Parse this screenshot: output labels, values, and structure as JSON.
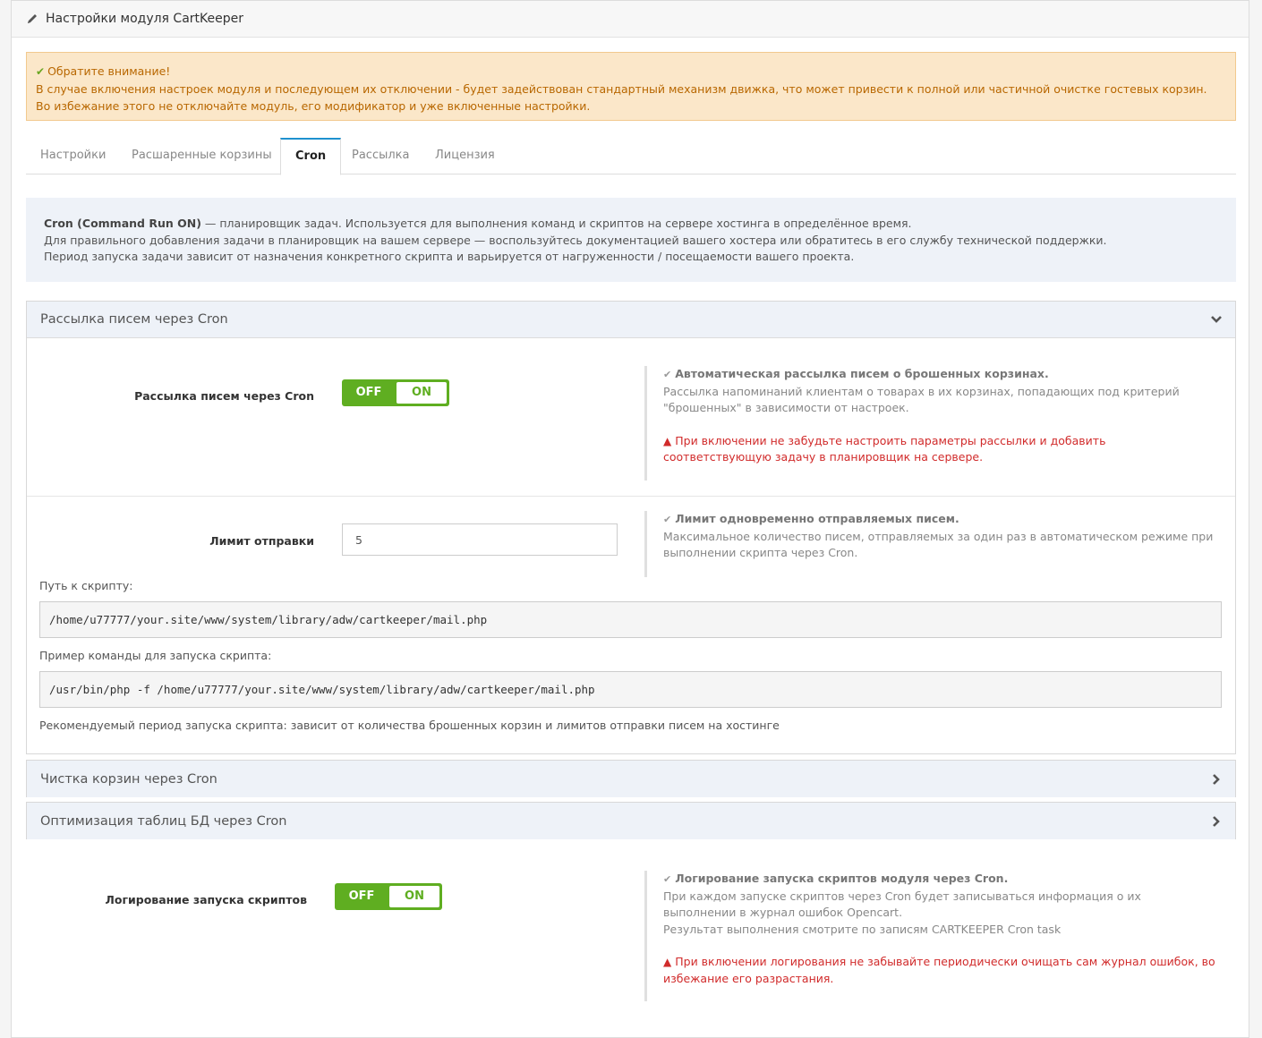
{
  "header": {
    "title": "Настройки модуля CartKeeper"
  },
  "alert": {
    "title": "Обратите внимание!",
    "line1": "В случае включения настроек модуля и последующем их отключении - будет задействован стандартный механизм движка, что может привести к полной или частичной очистке гостевых корзин.",
    "line2": "Во избежание этого не отключайте модуль, его модификатор и уже включенные настройки."
  },
  "tabs": [
    {
      "label": "Настройки"
    },
    {
      "label": "Расшаренные корзины"
    },
    {
      "label": "Cron"
    },
    {
      "label": "Рассылка"
    },
    {
      "label": "Лицензия"
    }
  ],
  "info": {
    "bold": "Cron (Command Run ON)",
    "line1_rest": " — планировщик задач. Используется для выполнения команд и скриптов на сервере хостинга в определённое время.",
    "line2": "Для правильного добавления задачи в планировщик на вашем сервере — воспользуйтесь документацией вашего хостера или обратитесь в его службу технической поддержки.",
    "line3": "Период запуска задачи зависит от назначения конкретного скрипта и варьируется от нагруженности / посещаемости вашего проекта."
  },
  "mail_section": {
    "title": "Рассылка писем через Cron",
    "toggle_label": "Рассылка писем через Cron",
    "toggle": {
      "off": "OFF",
      "on": "ON",
      "state": "on"
    },
    "help1": {
      "title": "Автоматическая рассылка писем о брошенных корзинах.",
      "text": "Рассылка напоминаний клиентам о товарах в их корзинах, попадающих под критерий \"брошенных\" в зависимости от настроек.",
      "warn": "При включении не забудьте настроить параметры рассылки и добавить соответствующую задачу в планировщик на сервере."
    },
    "limit_label": "Лимит отправки",
    "limit_value": "5",
    "help2": {
      "title": "Лимит одновременно отправляемых писем.",
      "text": "Максимальное количество писем, отправляемых за один раз в автоматическом режиме при выполнении скрипта через Cron."
    },
    "path_label": "Путь к скрипту:",
    "path_value": "/home/u77777/your.site/www/system/library/adw/cartkeeper/mail.php",
    "cmd_label": "Пример команды для запуска скрипта:",
    "cmd_value": "/usr/bin/php -f /home/u77777/your.site/www/system/library/adw/cartkeeper/mail.php",
    "recommend": "Рекомендуемый период запуска скрипта: зависит от количества брошенных корзин и лимитов отправки писем на хостинге"
  },
  "clean_section": {
    "title": "Чистка корзин через Cron"
  },
  "optimize_section": {
    "title": "Оптимизация таблиц БД через Cron"
  },
  "logging": {
    "label": "Логирование запуска скриптов",
    "toggle": {
      "off": "OFF",
      "on": "ON",
      "state": "on"
    },
    "help": {
      "title": "Логирование запуска скриптов модуля через Cron.",
      "text1": "При каждом запуске скриптов через Cron будет записываться информация о их выполнении в журнал ошибок Opencart.",
      "text2": "Результат выполнения смотрите по записям CARTKEEPER Cron task",
      "warn": "При включении логирования не забывайте периодически очищать сам журнал ошибок, во избежание его разрастания."
    }
  },
  "colors": {
    "accent": "#1e91cf",
    "toggle_green": "#5fae21",
    "warn_red": "#d12b2b",
    "alert_bg": "#fbe7c9"
  }
}
